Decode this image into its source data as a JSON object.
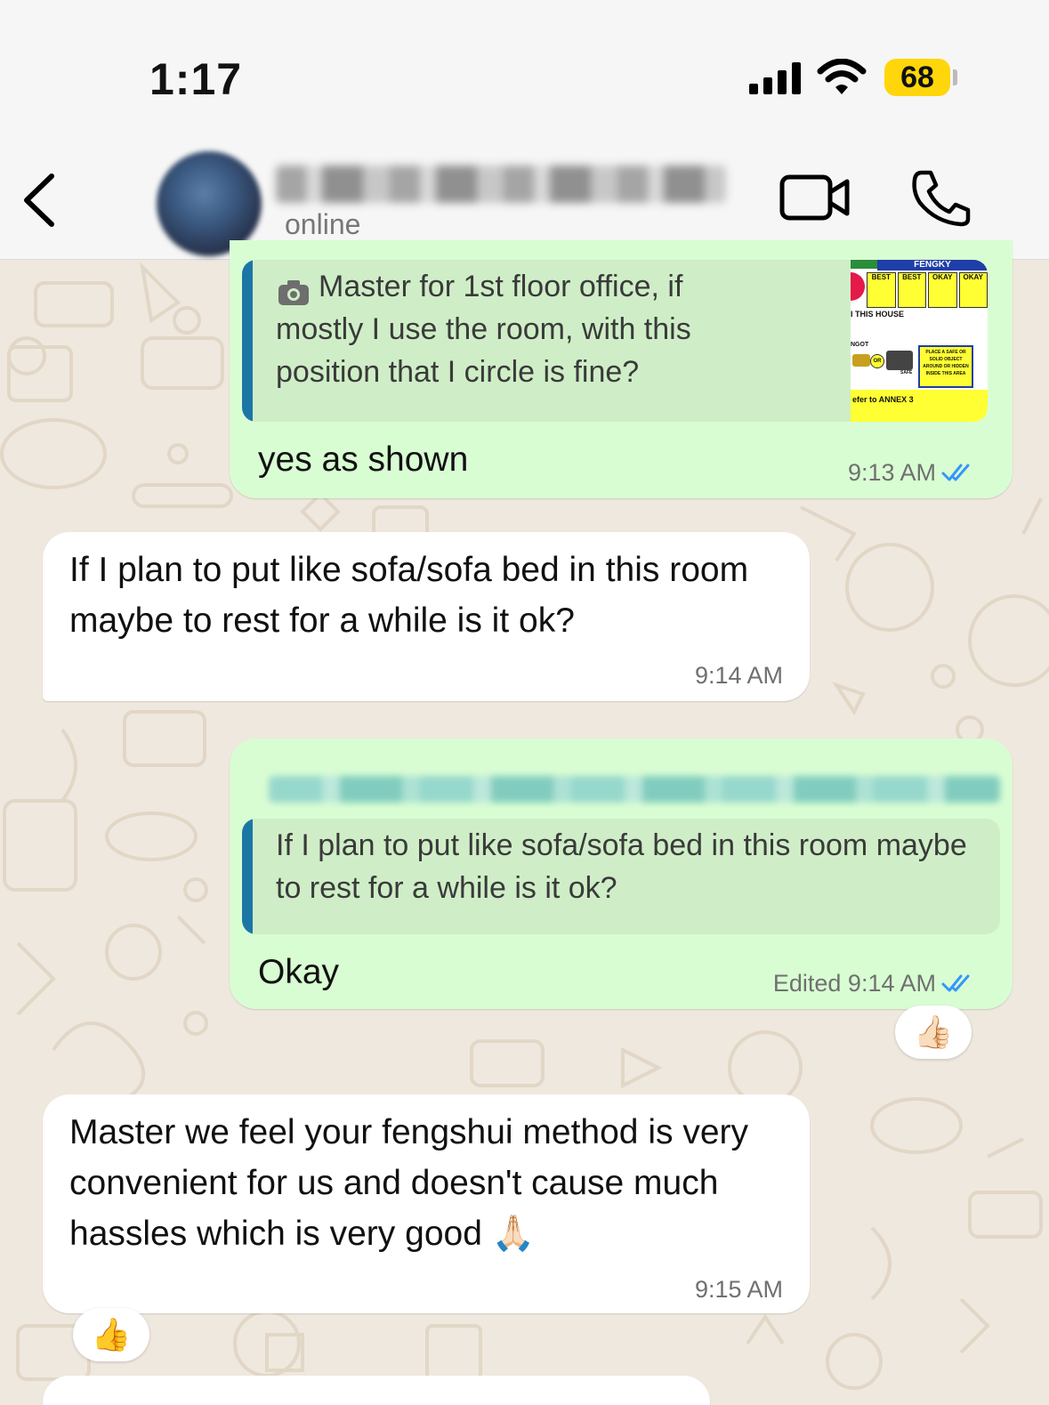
{
  "status_bar": {
    "time": "1:17",
    "battery": "68"
  },
  "header": {
    "status": "online"
  },
  "messages": [
    {
      "direction": "outgoing",
      "quoted_prefix_icon": "camera-icon",
      "quoted_text": "Master for 1st floor office, if mostly I use the room, with this position that I circle is fine?",
      "quoted_thumbnail": {
        "title": "FENGKY",
        "labels": [
          "BEST",
          "BEST",
          "OKAY",
          "OKAY"
        ],
        "line1": "I THIS HOUSE",
        "left_label": "NGOT",
        "or_label": "OR",
        "safe_label": "SAFE",
        "box_lines": [
          "PLACE A SAFE OR",
          "SOLID OBJECT",
          "AROUND OR HIDDEN",
          "INSIDE THIS AREA"
        ],
        "footer": "efer to ANNEX 3"
      },
      "text": "yes as shown",
      "time": "9:13 AM",
      "read": true
    },
    {
      "direction": "incoming",
      "text": "If I plan to put like sofa/sofa bed in this room maybe to rest for a while is it ok?",
      "time": "9:14 AM"
    },
    {
      "direction": "outgoing",
      "quoted_text": "If I plan to put like sofa/sofa bed in this room maybe to rest for a while is it ok?",
      "text": "Okay",
      "time": "Edited 9:14 AM",
      "read": true,
      "reaction": "👍🏻"
    },
    {
      "direction": "incoming",
      "text": "Master we feel your fengshui method is very convenient for us and doesn't cause much hassles which is very good 🙏🏻",
      "time": "9:15 AM",
      "reaction": "👍"
    }
  ],
  "colors": {
    "outgoing_bubble": "#d9fdd3",
    "incoming_bubble": "#ffffff",
    "quote_bar": "#1b76a6",
    "read_ticks": "#3497f9",
    "battery": "#ffd60a"
  }
}
